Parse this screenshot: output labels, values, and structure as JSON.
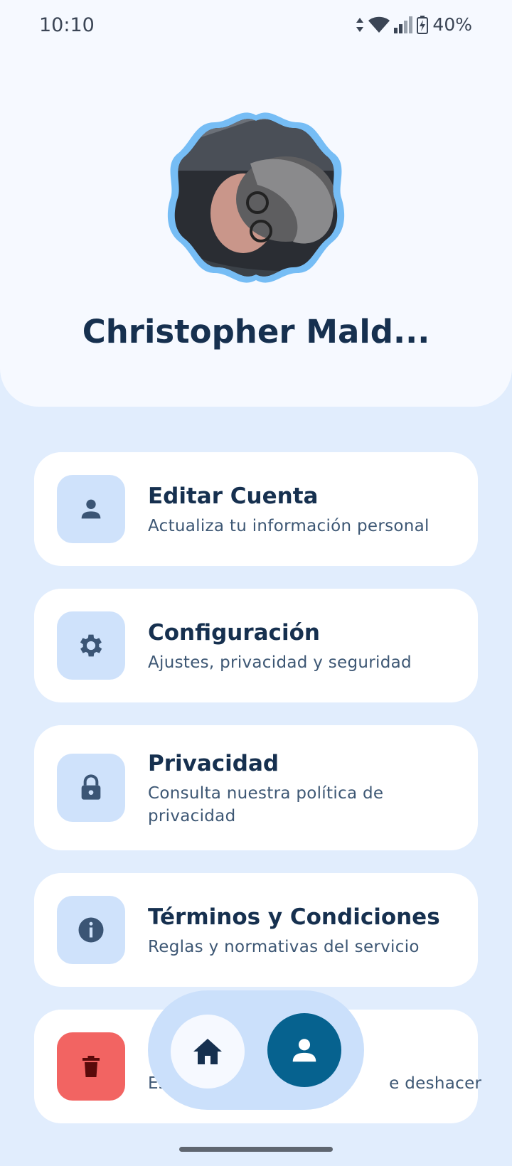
{
  "status_bar": {
    "time": "10:10",
    "battery": "40%"
  },
  "profile": {
    "name": "Christopher Mald..."
  },
  "menu": {
    "items": [
      {
        "title": "Editar Cuenta",
        "subtitle": "Actualiza tu información personal",
        "icon": "person-icon"
      },
      {
        "title": "Configuración",
        "subtitle": "Ajustes, privacidad y seguridad",
        "icon": "gear-icon"
      },
      {
        "title": "Privacidad",
        "subtitle": "Consulta nuestra política de privacidad",
        "icon": "lock-icon"
      },
      {
        "title": "Términos y Condiciones",
        "subtitle": "Reglas y normativas del servicio",
        "icon": "info-icon"
      },
      {
        "title": "",
        "subtitle": "Es                                         e deshacer",
        "icon": "trash-icon"
      }
    ]
  },
  "nav": {
    "items": [
      {
        "icon": "home-icon"
      },
      {
        "icon": "person-icon",
        "active": true
      }
    ]
  },
  "colors": {
    "accent": "#06628f",
    "danger": "#f26462",
    "icon_bg": "#cfe2fb",
    "background": "#e1edfd"
  }
}
